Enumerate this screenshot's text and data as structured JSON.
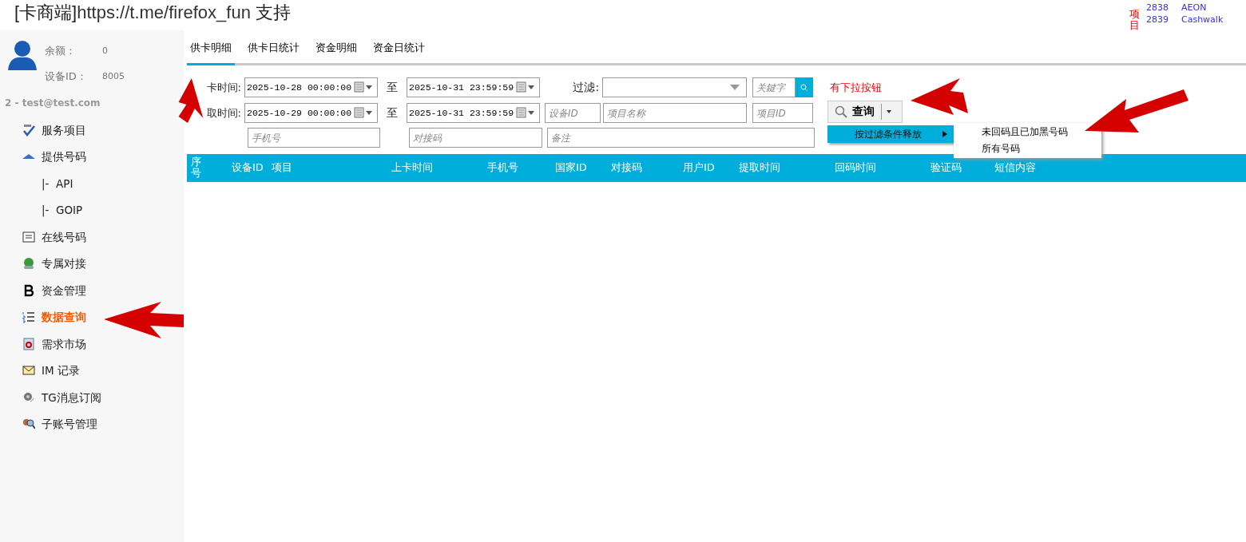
{
  "header": {
    "title_bracket": "[卡商端]",
    "title_link": "https://t.me/firefox_fun",
    "title_suffix": "支持"
  },
  "news": {
    "label": "项目",
    "items": [
      {
        "id": "2838",
        "name": "AEON"
      },
      {
        "id": "2839",
        "name": "Cashwalk"
      }
    ]
  },
  "account": {
    "balance_label": "余额：",
    "balance": "0",
    "device_label": "设备ID：",
    "device": "8005",
    "user": "2 - test@test.com"
  },
  "sidebar": {
    "items": [
      {
        "label": "服务项目",
        "kind": "item",
        "selected": false
      },
      {
        "label": "提供号码",
        "kind": "item",
        "selected": false
      },
      {
        "label": "|-  API",
        "kind": "sub",
        "selected": false
      },
      {
        "label": "|-  GOIP",
        "kind": "sub",
        "selected": false
      },
      {
        "label": "在线号码",
        "kind": "item",
        "selected": false
      },
      {
        "label": "专属对接",
        "kind": "item",
        "selected": false
      },
      {
        "label": "资金管理",
        "kind": "item",
        "selected": false
      },
      {
        "label": "数据查询",
        "kind": "item",
        "selected": true
      },
      {
        "label": "需求市场",
        "kind": "item",
        "selected": false
      },
      {
        "label": "IM 记录",
        "kind": "item",
        "selected": false
      },
      {
        "label": "TG消息订阅",
        "kind": "item",
        "selected": false
      },
      {
        "label": "子账号管理",
        "kind": "item",
        "selected": false
      }
    ]
  },
  "tabs": [
    {
      "label": "供卡明细",
      "selected": true
    },
    {
      "label": "供卡日统计",
      "selected": false
    },
    {
      "label": "资金明细",
      "selected": false
    },
    {
      "label": "资金日统计",
      "selected": false
    }
  ],
  "filters": {
    "row1_label": "卡时间:",
    "row1_from": "2025-10-28 00:00:00",
    "row1_to": "2025-10-31 23:59:59",
    "row2_label": "取时间:",
    "row2_from": "2025-10-29 00:00:00",
    "row2_to": "2025-10-31 23:59:59",
    "to_label_1": "至",
    "to_label_2": "至",
    "filter_label": "过滤:",
    "keyword_placeholder": "关鍵字",
    "device_placeholder": "设备ID",
    "project_name_placeholder": "项目名称",
    "project_id_placeholder": "项目ID",
    "phone_placeholder": "手机号",
    "code_placeholder": "对接码",
    "remark_placeholder": "备注"
  },
  "query": {
    "note": "有下拉按钮",
    "button": "查询",
    "menu_item": "按过滤条件释放",
    "submenu": [
      "未回码且已加黑号码",
      "所有号码"
    ]
  },
  "table": {
    "columns": [
      "序号",
      "设备ID",
      "项目",
      "上卡时间",
      "手机号",
      "国家ID",
      "对接码",
      "用户ID",
      "提取时间",
      "回码时间",
      "验证码",
      "短信内容"
    ]
  }
}
